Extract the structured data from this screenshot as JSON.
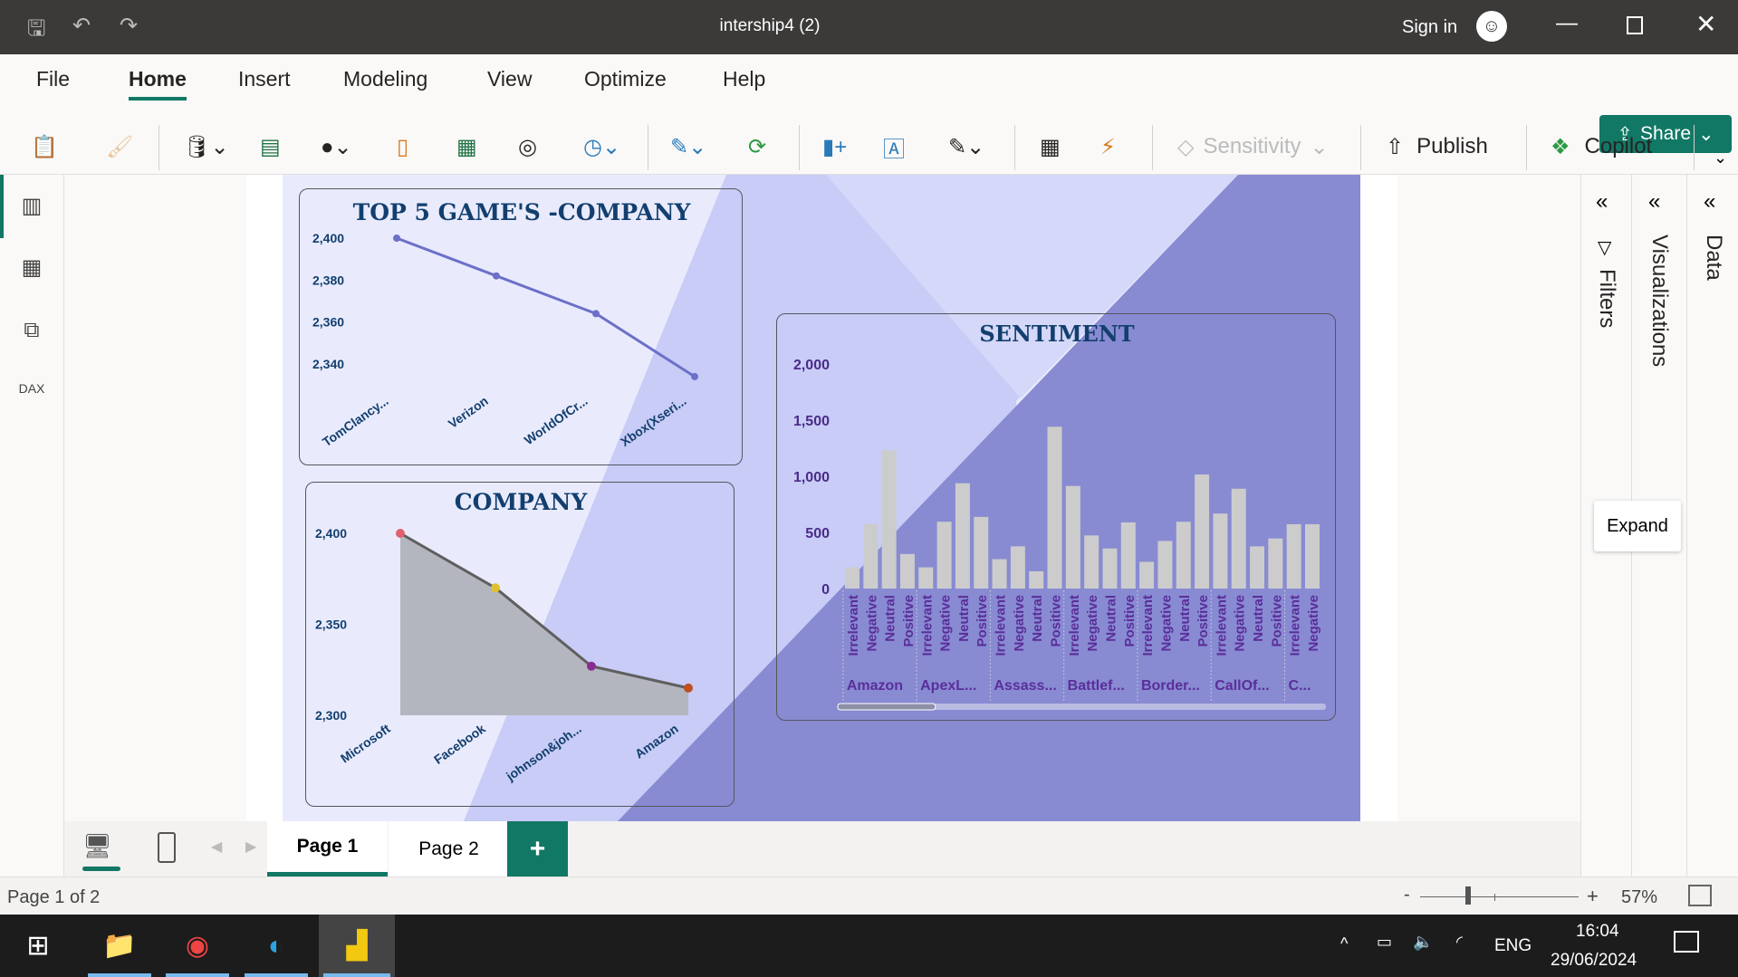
{
  "window": {
    "title": "intership4 (2)",
    "sign_in": "Sign in"
  },
  "menu": [
    "File",
    "Home",
    "Insert",
    "Modeling",
    "View",
    "Optimize",
    "Help"
  ],
  "share": "Share",
  "ribbon": {
    "sensitivity": "Sensitivity",
    "publish": "Publish",
    "copilot": "Copilot"
  },
  "panes": {
    "filters": "Filters",
    "visualizations": "Visualizations",
    "data": "Data",
    "expand_tooltip": "Expand"
  },
  "page_tabs": [
    "Page 1",
    "Page 2"
  ],
  "add_page": "+",
  "status": {
    "page_info": "Page 1 of 2",
    "zoom": "57%",
    "zoom_minus": "-",
    "zoom_plus": "+",
    "zoom_fraction": 0.57
  },
  "taskbar": {
    "lang": "ENG",
    "time": "16:04",
    "date": "29/06/2024"
  },
  "chart_data": [
    {
      "type": "line",
      "title": "TOP 5 GAME'S -COMPANY",
      "categories": [
        "TomClancy...",
        "Verizon",
        "WorldOfCr...",
        "Xbox(Xseri..."
      ],
      "values": [
        2400,
        2382,
        2364,
        2334
      ],
      "yticks": [
        "2,400",
        "2,380",
        "2,360",
        "2,340"
      ],
      "ylim": [
        2334,
        2400
      ],
      "color": "#6c70c8"
    },
    {
      "type": "area",
      "title": "COMPANY",
      "categories": [
        "Microsoft",
        "Facebook",
        "johnson&joh...",
        "Amazon"
      ],
      "values": [
        2400,
        2370,
        2327,
        2315
      ],
      "yticks": [
        "2,400",
        "2,350",
        "2,300"
      ],
      "ylim": [
        2300,
        2400
      ],
      "point_colors": [
        "#e06070",
        "#e0c030",
        "#8a2d90",
        "#c05020"
      ]
    },
    {
      "type": "bar",
      "title": "SENTIMENT",
      "groups": [
        "Amazon",
        "ApexL...",
        "Assass...",
        "Battlef...",
        "Border...",
        "CallOf...",
        "C..."
      ],
      "categories": [
        "Irrelevant",
        "Negative",
        "Neutral",
        "Positive",
        "Irrelevant",
        "Negative",
        "Neutral",
        "Positive",
        "Irrelevant",
        "Negative",
        "Neutral",
        "Positive",
        "Irrelevant",
        "Negative",
        "Neutral",
        "Positive",
        "Irrelevant",
        "Negative",
        "Neutral",
        "Positive",
        "Irrelevant",
        "Negative",
        "Neutral",
        "Positive",
        "Irrelevant",
        "Negative"
      ],
      "values": [
        189,
        573,
        1232,
        308,
        189,
        595,
        938,
        638,
        262,
        376,
        154,
        1441,
        914,
        473,
        357,
        589,
        238,
        424,
        595,
        1016,
        668,
        889,
        376,
        446,
        573,
        573
      ],
      "yticks": [
        "2,000",
        "1,500",
        "1,000",
        "500",
        "0"
      ],
      "ylim": [
        0,
        2000
      ],
      "scroll_position": 0.2
    }
  ]
}
